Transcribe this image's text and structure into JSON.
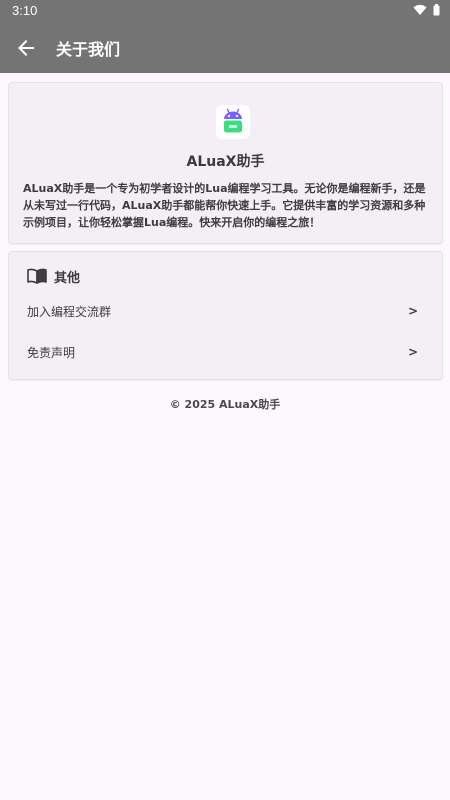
{
  "status_bar": {
    "time": "3:10",
    "wifi_icon": "wifi-icon",
    "battery_icon": "battery-icon"
  },
  "app_bar": {
    "back_icon": "arrow-back-icon",
    "title": "关于我们"
  },
  "about": {
    "app_name": "ALuaX助手",
    "description": "ALuaX助手是一个专为初学者设计的Lua编程学习工具。无论你是编程新手，还是从未写过一行代码，ALuaX助手都能帮你快速上手。它提供丰富的学习资源和多种示例项目，让你轻松掌握Lua编程。快来开启你的编程之旅！",
    "logo_icon": "android-robot-icon",
    "logo_colors": {
      "body": "#3ddc84",
      "head": "#7b61ff"
    }
  },
  "other": {
    "icon": "book-icon",
    "title": "其他",
    "items": [
      {
        "label": "加入编程交流群",
        "arrow": ">"
      },
      {
        "label": "免责声明",
        "arrow": ">"
      }
    ]
  },
  "footer": {
    "copyright": "© 2025 ALuaX助手"
  },
  "colors": {
    "app_bar": "#747474",
    "background": "#fdf8fd",
    "card": "#f4eff4"
  }
}
